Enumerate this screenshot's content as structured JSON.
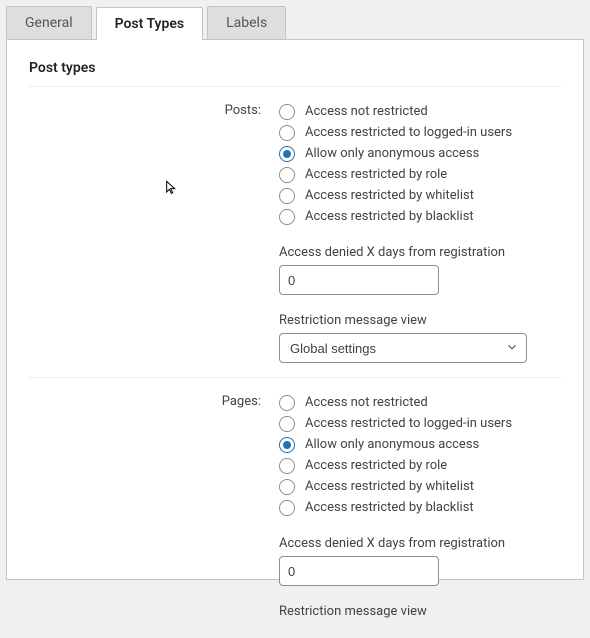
{
  "tabs": {
    "general": "General",
    "post_types": "Post Types",
    "labels": "Labels"
  },
  "section_title": "Post types",
  "posts": {
    "label": "Posts:",
    "options": {
      "o0": "Access not restricted",
      "o1": "Access restricted to logged-in users",
      "o2": "Allow only anonymous access",
      "o3": "Access restricted by role",
      "o4": "Access restricted by whitelist",
      "o5": "Access restricted by blacklist"
    },
    "denied_days_label": "Access denied X days from registration",
    "denied_days_value": "0",
    "message_view_label": "Restriction message view",
    "message_view_value": "Global settings"
  },
  "pages": {
    "label": "Pages:",
    "options": {
      "o0": "Access not restricted",
      "o1": "Access restricted to logged-in users",
      "o2": "Allow only anonymous access",
      "o3": "Access restricted by role",
      "o4": "Access restricted by whitelist",
      "o5": "Access restricted by blacklist"
    },
    "denied_days_label": "Access denied X days from registration",
    "denied_days_value": "0",
    "message_view_label": "Restriction message view"
  }
}
